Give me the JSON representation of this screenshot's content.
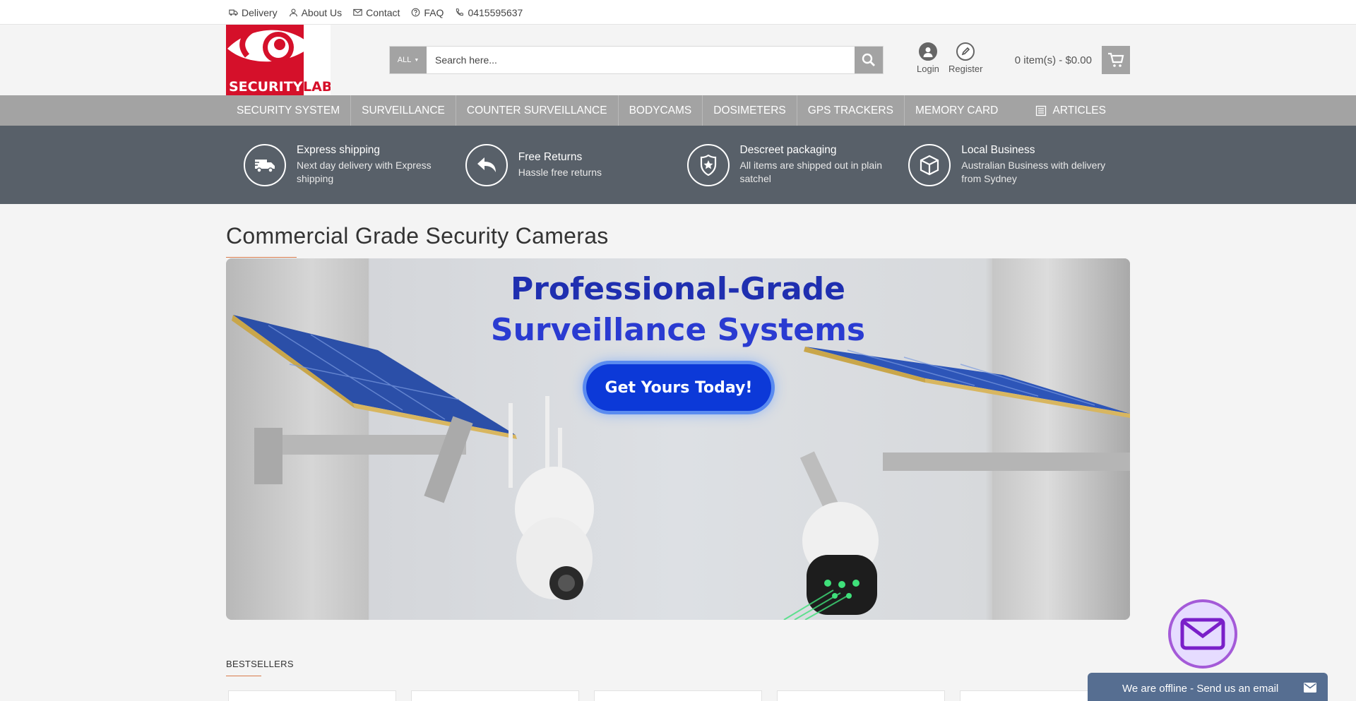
{
  "topbar": {
    "links": [
      {
        "label": "Delivery",
        "icon": "truck-icon"
      },
      {
        "label": "About Us",
        "icon": "user-icon"
      },
      {
        "label": "Contact",
        "icon": "envelope-icon"
      },
      {
        "label": "FAQ",
        "icon": "question-icon"
      },
      {
        "label": "0415595637",
        "icon": "phone-icon"
      }
    ]
  },
  "brand": {
    "name": "SECURITYLAB",
    "part1": "SECURITY",
    "part2": "LAB",
    "color": "#d5102a"
  },
  "search": {
    "category": "ALL",
    "placeholder": "Search here..."
  },
  "account": {
    "login": "Login",
    "register": "Register"
  },
  "cart": {
    "summary": "0 item(s) - $0.00"
  },
  "nav": {
    "items": [
      "SECURITY SYSTEM",
      "SURVEILLANCE",
      "COUNTER SURVEILLANCE",
      "BODYCAMS",
      "DOSIMETERS",
      "GPS TRACKERS",
      "MEMORY CARD"
    ],
    "articles": "ARTICLES"
  },
  "features": [
    {
      "title": "Express shipping",
      "text": "Next day delivery with Express shipping",
      "icon": "delivery-truck-icon"
    },
    {
      "title": "Free Returns",
      "text": "Hassle free returns",
      "icon": "return-arrow-icon"
    },
    {
      "title": "Descreet packaging",
      "text": "All items are shipped out in plain satchel",
      "icon": "badge-star-icon"
    },
    {
      "title": "Local Business",
      "text": "Australian Business with delivery from Sydney",
      "icon": "box-icon"
    }
  ],
  "main": {
    "heading": "Commercial Grade Security Cameras"
  },
  "banner": {
    "line1": "Professional-Grade",
    "line2": "Surveillance Systems",
    "cta": "Get Yours Today!"
  },
  "bestsellers": {
    "label": "BESTSELLERS"
  },
  "chat": {
    "status": "We are offline - Send us an email"
  },
  "colors": {
    "accent": "#d87a4a",
    "nav": "#a3a3a3",
    "band": "#586069",
    "chat": "#566e91"
  }
}
